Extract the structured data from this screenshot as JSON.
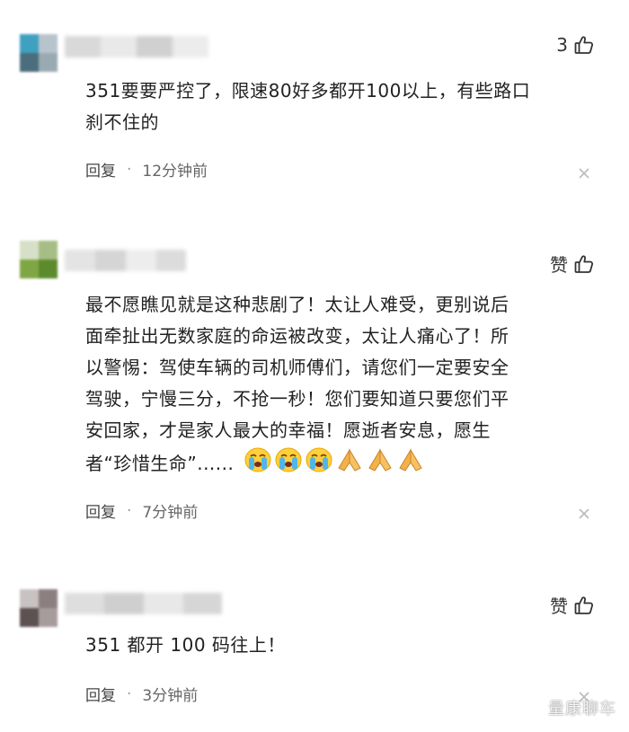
{
  "comments": [
    {
      "likes_label": "3",
      "text_lines": [
        "351要要严控了，限速80好多都开100以上，有些路口",
        "刹不住的"
      ],
      "reply_label": "回复",
      "separator": "·",
      "time": "12分钟前"
    },
    {
      "likes_label": "赞",
      "text_lines": [
        "最不愿瞧见就是这种悲剧了！太让人难受，更别说后",
        "面牵扯出无数家庭的命运被改变，太让人痛心了！所",
        "以警惕：驾使车辆的司机师傅们，请您们一定要安全",
        "驾驶，宁慢三分，不抢一秒！您们要知道只要您们平",
        "安回家，才是家人最大的幸福！愿逝者安息，愿生",
        "者“珍惜生命”......"
      ],
      "emojis": [
        "loudly-crying-face",
        "loudly-crying-face",
        "loudly-crying-face",
        "folded-hands",
        "folded-hands",
        "folded-hands"
      ],
      "reply_label": "回复",
      "separator": "·",
      "time": "7分钟前"
    },
    {
      "likes_label": "赞",
      "text_lines": [
        "351 都开 100 码往上！"
      ],
      "reply_label": "回复",
      "separator": "·",
      "time": "3分钟前"
    }
  ],
  "watermark": "量康聊车",
  "colors": {
    "text": "#222222",
    "meta": "#666666",
    "icon": "#333333"
  }
}
